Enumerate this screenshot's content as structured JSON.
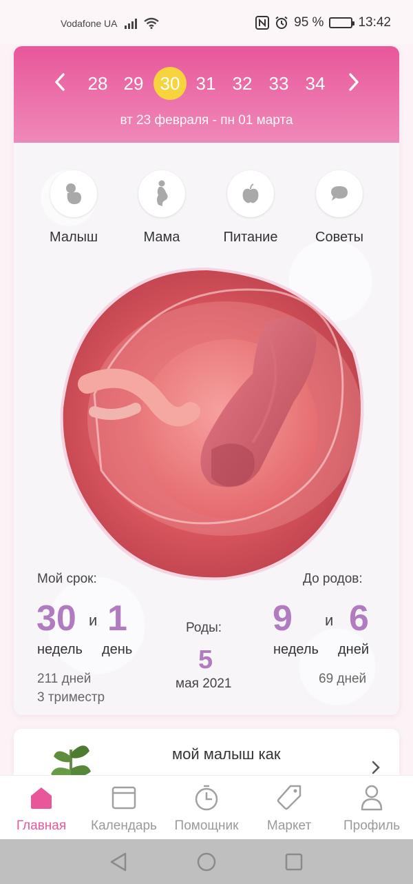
{
  "status_bar": {
    "carrier": "Vodafone UA",
    "battery": "95 %",
    "time": "13:42"
  },
  "week_selector": {
    "weeks": [
      "28",
      "29",
      "30",
      "31",
      "32",
      "33",
      "34"
    ],
    "active_week": "30",
    "range": "вт 23 февраля - пн 01 марта"
  },
  "categories": [
    {
      "label": "Малыш",
      "icon": "baby-icon"
    },
    {
      "label": "Мама",
      "icon": "pregnant-mother-icon"
    },
    {
      "label": "Питание",
      "icon": "apple-icon"
    },
    {
      "label": "Советы",
      "icon": "chat-bubble-icon"
    }
  ],
  "stats": {
    "term_label": "Мой срок:",
    "term_weeks": "30",
    "term_and": "и",
    "term_days": "1",
    "term_weeks_unit": "недель",
    "term_days_unit": "день",
    "term_total_days": "211 дней",
    "trimester": "3 триместр",
    "due_label": "Роды:",
    "due_day": "5",
    "due_month_year": "мая 2021",
    "left_label": "До родов:",
    "left_weeks": "9",
    "left_and": "и",
    "left_days": "6",
    "left_weeks_unit": "недель",
    "left_days_unit": "дней",
    "left_total_days": "69 дней"
  },
  "article": {
    "title": "мой малыш как"
  },
  "tabs": [
    {
      "label": "Главная",
      "icon": "home-icon",
      "active": true
    },
    {
      "label": "Календарь",
      "icon": "calendar-icon",
      "active": false
    },
    {
      "label": "Помощник",
      "icon": "stopwatch-icon",
      "active": false
    },
    {
      "label": "Маркет",
      "icon": "price-tag-icon",
      "active": false
    },
    {
      "label": "Профиль",
      "icon": "profile-icon",
      "active": false
    }
  ],
  "colors": {
    "accent": "#e8579a",
    "header_gradient_end": "#ef89b9",
    "active_week_bg": "#f7d33d",
    "stat_number": "#b07cbf"
  }
}
